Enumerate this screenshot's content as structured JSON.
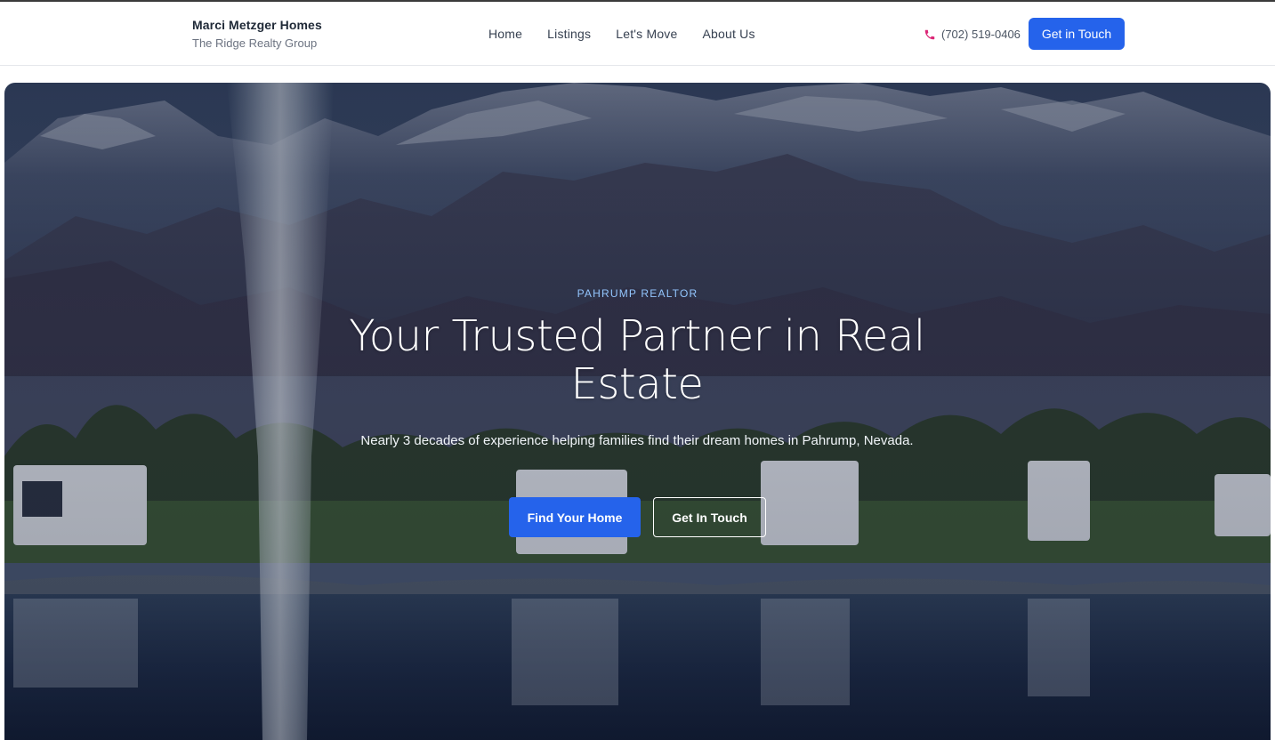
{
  "header": {
    "brand_name": "Marci Metzger Homes",
    "brand_sub": "The Ridge Realty Group",
    "nav": [
      "Home",
      "Listings",
      "Let's Move",
      "About Us"
    ],
    "phone": "(702) 519-0406",
    "cta_label": "Get in Touch"
  },
  "hero": {
    "eyebrow": "PAHRUMP REALTOR",
    "title": "Your Trusted Partner in Real Estate",
    "subtitle": "Nearly 3 decades of experience helping families find their dream homes in Pahrump, Nevada.",
    "primary_button": "Find Your Home",
    "secondary_button": "Get In Touch"
  },
  "icons": {
    "phone": "phone-icon"
  },
  "colors": {
    "accent": "#2563eb",
    "eyebrow": "#93c5fd",
    "phone_icon": "#db2777"
  }
}
